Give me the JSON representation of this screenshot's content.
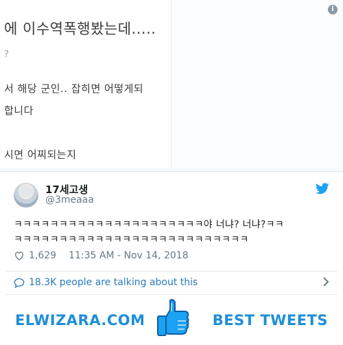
{
  "image": {
    "lines": [
      "에 이수역폭행봤는데.....",
      "?",
      "서 해당 군인.. 잡히면 어떻게되",
      "합니다",
      "시면 어찌되는지"
    ]
  },
  "tweet": {
    "display_name": "17세고생",
    "handle": "@3meaaa",
    "text_line1": "ㅋㅋㅋㅋㅋㅋㅋㅋㅋㅋㅋㅋㅋㅋㅋㅋㅋㅋㅋㅋㅋ야 너냐? 너냐?ㅋㅋ",
    "text_line2": "ㅋㅋㅋㅋㅋㅋㅋㅋㅋㅋㅋㅋㅋㅋㅋㅋㅋㅋㅋㅋㅋㅋㅋㅋㅋㅋ",
    "likes": "1,629",
    "timestamp": "11:35 AM - Nov 14, 2018",
    "talking": "18.3K people are talking about this"
  },
  "banner": {
    "brand": "ELWIZARA.COM",
    "tagline": "BEST TWEETS"
  },
  "colors": {
    "twitter_blue": "#1da1f2",
    "link_blue": "#2b7bb9",
    "banner_blue": "#1f8fd6",
    "muted": "#697882"
  },
  "icons": [
    "info-icon",
    "twitter-bird-icon",
    "heart-icon",
    "speech-bubble-icon",
    "chevron-right-icon",
    "thumbs-up-icon"
  ]
}
